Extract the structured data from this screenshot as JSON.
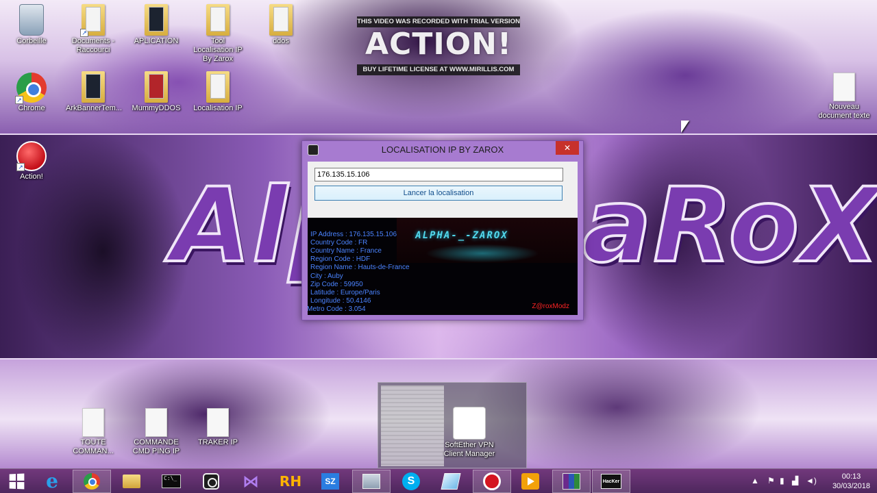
{
  "watermark": {
    "top": "THIS VIDEO WAS RECORDED WITH TRIAL VERSION",
    "logo": "ACTION!",
    "bottom": "BUY LIFETIME LICENSE AT WWW.MIRILLIS.COM"
  },
  "wallpaper": {
    "banner_left": "Alp",
    "banner_right": "aRoX"
  },
  "desktop_icons": {
    "corbeille": "Corbeille",
    "documents": "Documents - Raccourci",
    "aplication": "APLICATION",
    "tool_localisation": "Tool Localisation IP By Zarox",
    "ddos": "ddos",
    "chrome": "Chrome",
    "arkbanner": "ArkBannerTem...",
    "mummyddos": "MummyDDOS",
    "localisation_ip": "Localisation IP",
    "action": "Action!",
    "nouveau": "Nouveau document texte",
    "toute_command": "TOUTE COMMAN...",
    "commande_cmd": "COMMANDE CMD PING IP",
    "traker_ip": "TRAKER IP",
    "softether": "SoftEther VPN Client Manager"
  },
  "dialog": {
    "title": "LOCALISATION IP BY ZAROX",
    "close_label": "✕",
    "ip_value": "176.135.15.106",
    "button_label": "Lancer la localisation",
    "banner_text": "ALPHA-_-ZAROX",
    "results": {
      "ip_address": "IP Address : 176.135.15.106",
      "country_code": "Country Code : FR",
      "country_name": "Country Name : France",
      "region_code": "Region Code : HDF",
      "region_name": "Region Name : Hauts-de-France",
      "city": "City : Auby",
      "zip_code": "Zip Code : 59950",
      "latitude": "Latitude : Europe/Paris",
      "longitude": "Longitude : 50.4146",
      "metro_code": "Metro Code : 3.054"
    },
    "signature": "Z@roxModz"
  },
  "taskbar": {
    "rh_label": "RH",
    "sz_label": "SZ",
    "skype_label": "S",
    "hack_label": "HacKer",
    "cmd_label": "C:\\_",
    "clock_time": "00:13",
    "clock_date": "30/03/2018"
  },
  "colors": {
    "dialog_frame": "#a77bd0",
    "result_text": "#4b84ff",
    "signature": "#ff2424",
    "close_button": "#c7312b"
  }
}
